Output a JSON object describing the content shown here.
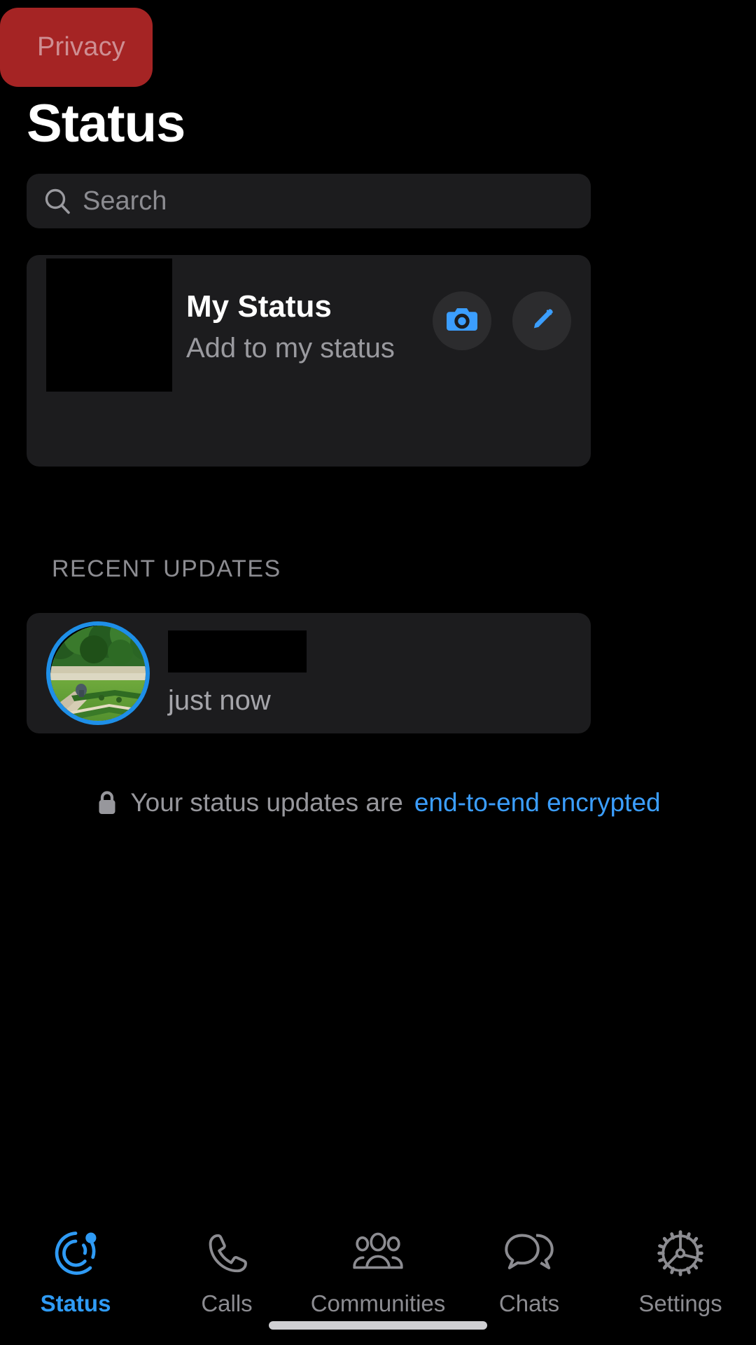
{
  "nav": {
    "back_label": "Privacy"
  },
  "header": {
    "title": "Status"
  },
  "search": {
    "placeholder": "Search",
    "icon": "search-icon"
  },
  "my_status": {
    "title": "My Status",
    "subtitle": "Add to my status",
    "camera_icon": "camera-icon",
    "pencil_icon": "pencil-icon"
  },
  "recent_updates": {
    "section_label": "RECENT UPDATES",
    "items": [
      {
        "name": "",
        "time": "just now",
        "unseen": true
      }
    ]
  },
  "encryption": {
    "lock_icon": "lock-icon",
    "text": "Your status updates are",
    "link": "end-to-end encrypted"
  },
  "tabbar": {
    "items": [
      {
        "label": "Status",
        "icon": "status-ring-icon",
        "active": true
      },
      {
        "label": "Calls",
        "icon": "phone-icon",
        "active": false
      },
      {
        "label": "Communities",
        "icon": "communities-icon",
        "active": false
      },
      {
        "label": "Chats",
        "icon": "chat-bubbles-icon",
        "active": false
      },
      {
        "label": "Settings",
        "icon": "gear-icon",
        "active": false
      }
    ]
  },
  "colors": {
    "accent": "#3B9EFF",
    "privacy_button_bg": "#A52424",
    "privacy_button_text": "#CE8E92",
    "card_bg": "#1C1C1E",
    "secondary_text": "#8C8C91",
    "ring": "#1E8FE8"
  }
}
